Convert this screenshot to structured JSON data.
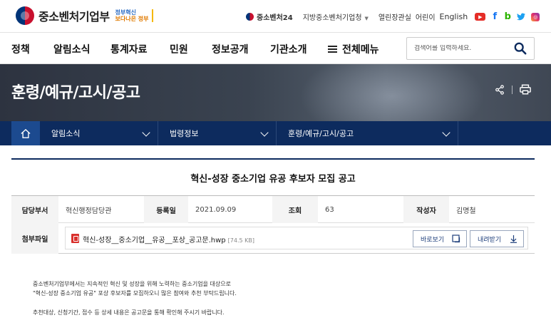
{
  "header": {
    "logo_text": "중소벤처기업부",
    "logo_sub_line1": "정부혁신",
    "logo_sub_line2": "보다나은 정부",
    "links": {
      "mss24": "중소벤처24",
      "regional": "지방중소벤처기업청",
      "open_office": "열린장관실",
      "kids": "어린이",
      "english": "English"
    },
    "sns": [
      "youtube-icon",
      "facebook-icon",
      "blog-icon",
      "twitter-icon",
      "instagram-icon"
    ]
  },
  "nav": {
    "items": [
      "정책",
      "알림소식",
      "통계자료",
      "민원",
      "정보공개",
      "기관소개"
    ],
    "all_menu": "전체메뉴",
    "search_placeholder": "검색어를 입력하세요."
  },
  "banner": {
    "title": "훈령/예규/고시/공고"
  },
  "location": {
    "level1": "알림소식",
    "level2": "법령정보",
    "level3": "훈령/예규/고시/공고"
  },
  "article": {
    "title": "혁신-성장 중소기업 유공 후보자 모집 공고",
    "dept_label": "담당부서",
    "dept_value": "혁신행정담당관",
    "date_label": "등록일",
    "date_value": "2021.09.09",
    "views_label": "조회",
    "views_value": "63",
    "author_label": "작성자",
    "author_value": "김명철",
    "attach_label": "첨부파일",
    "file_name": "혁신-성장__중소기업__유공__포상_공고문.hwp",
    "file_size": "[74.5 KB]",
    "preview_button": "바로보기",
    "download_button": "내려받기",
    "body": [
      "중소벤처기업부에서는 지속적인 혁신 및 성장을 위해 노력하는 중소기업을 대상으로",
      "\"혁신-성장 중소기업 유공\" 포상 후보자를 모집하오니 많은 참여와 추천 부탁드립니다.",
      "추천대상, 신청기간, 접수 등 상세 내용은 공고문을 통해 확인해 주시기 바랍니다."
    ]
  },
  "colors": {
    "primary_navy": "#0d2b5e",
    "home_blue": "#1c4a8f",
    "hwp_red": "#d9302c"
  }
}
